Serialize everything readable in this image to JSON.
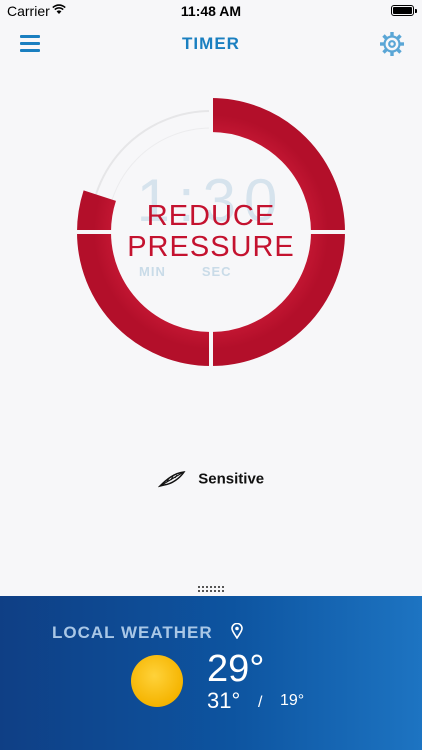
{
  "status_bar": {
    "carrier": "Carrier",
    "time": "11:48 AM"
  },
  "nav": {
    "title": "TIMER",
    "menu_icon": "hamburger-menu-icon",
    "settings_icon": "gear-icon"
  },
  "timer": {
    "ghost_digits": "1:30",
    "unit_min": "MIN",
    "unit_sec": "SEC",
    "message_line1": "REDUCE",
    "message_line2": "PRESSURE",
    "progress_fraction": 0.8,
    "ring_color": "#c4122f",
    "track_color": "#e4e4e6"
  },
  "sensitivity": {
    "label": "Sensitive",
    "icon": "feather-icon"
  },
  "weather": {
    "title": "LOCAL WEATHER",
    "location_icon": "location-pin-icon",
    "condition_icon": "sun-icon",
    "current_temp": "29°",
    "high": "31°",
    "separator": "/",
    "low": "19°",
    "accent": "#0d54a0"
  }
}
